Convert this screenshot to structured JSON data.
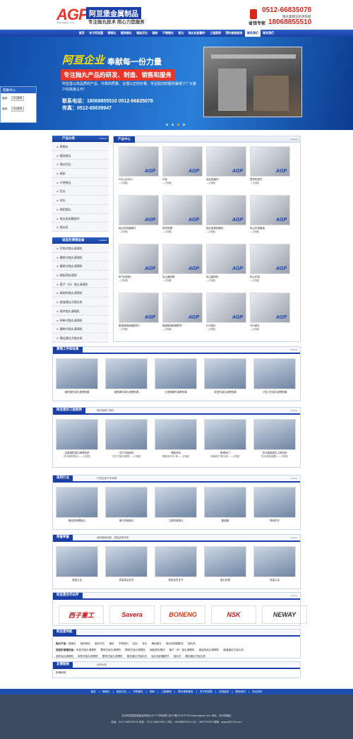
{
  "header": {
    "logo": "AGP",
    "logo_sub": "www.agpzp.com",
    "company": "阿亘堡金属制品",
    "slogan": "专注抛丸技术 用心力您服务",
    "phone1": "0512-66835078",
    "phone_tag": "钢丸集销读砂项购者",
    "phone2_label": "省钱专家",
    "phone2": "18068855510"
  },
  "nav": [
    "首页",
    "关于阿亘堡",
    "铸钢丸",
    "镀锌钢丸",
    "钢丝切丸",
    "钢砂",
    "不锈钢丸",
    "铝丸",
    "抛丸机耐磨件",
    "工程案例",
    "预约维修服务",
    "联系我们",
    "联系我们"
  ],
  "banner": {
    "title": "阿亘企业",
    "tagline": "奉献每一份力量",
    "bar": "专注抛丸产品的研发、制造、销售和服务",
    "text": "阿亘堡以高品质的产品、可靠的质量、合理公正的价格、专业贴切的服务赢得了广大客户的高度认可!",
    "tel_line": "联系电话：18068855510 0512-66835078",
    "fax_line": "传真：0512-68639947"
  },
  "kefu": {
    "title": "客服中心",
    "rows": [
      {
        "label": "客服：",
        "btn": "QQ咨询"
      },
      {
        "label": "客服：",
        "btn": "QQ咨询"
      }
    ]
  },
  "sidebar1": {
    "title": "产品分类",
    "more": "+more",
    "items": [
      "铸钢丸",
      "镀锌钢丸",
      "钢丝切丸",
      "钢砂",
      "不锈钢丸",
      "铝丸",
      "锌丸",
      "铸铝钢丸",
      "抛丸机耐磨配件",
      "抛丸机"
    ]
  },
  "sidebar2": {
    "title": "适宜的清理设备",
    "more": "+more",
    "items": [
      "吊钩式抛丸清理机",
      "履带式抛丸清理机",
      "履带式抛丸清理机",
      "钢板预处理线",
      "管子（外）抛丸清理机",
      "钢结构抛丸清理机",
      "辊道通过式抛丸机",
      "钢件抛丸清理机",
      "网带式抛丸清理机",
      "履带式抛丸清理机",
      "悬挂通过式抛丸机"
    ]
  },
  "products": {
    "title": "产品中心",
    "more": "+more",
    "items": [
      {
        "name": "叶片(全为叶)",
        "more": "—[详细]"
      },
      {
        "name": "叶轮",
        "more": "—[详细]"
      },
      {
        "name": "抛丸耐磨件",
        "more": "—[详细]"
      },
      {
        "name": "里弄机配件",
        "more": "—[详细]"
      },
      {
        "name": "抛丸机耐磨套件",
        "more": "—[详细]"
      },
      {
        "name": "滚环配置",
        "more": "—[详细]"
      },
      {
        "name": "抛丸铸造耐磨件",
        "more": "—[详细]"
      },
      {
        "name": "除尘布袋套装",
        "more": "—[详细]"
      },
      {
        "name": "电气控制柜",
        "more": "—[详细]"
      },
      {
        "name": "除尘器滤筒",
        "more": "—[详细]"
      },
      {
        "name": "除尘器风机",
        "more": "—[详细]"
      },
      {
        "name": "除尘布袋",
        "more": "—[详细]"
      },
      {
        "name": "管道铸造耐磨配件2",
        "more": "—[详细]"
      },
      {
        "name": "管道铸造耐磨配件",
        "more": "—[详细]"
      },
      {
        "name": "834抛丸",
        "more": "—[详细]"
      },
      {
        "name": "360抛丸",
        "more": "—[详细]"
      }
    ]
  },
  "effect": {
    "title": "清理工件和效果",
    "more": "+more",
    "items": [
      "钢铁铸件抛丸清理效果",
      "钢铁铸件抛丸清理效果",
      "大型铸钢件清理效果",
      "异型件抛丸清理效果",
      "小型工件抛丸清理效果"
    ]
  },
  "cases": {
    "title": "阿亘堡的工程案例",
    "subtitle": "他们选择了我们",
    "more": "+more",
    "items": [
      {
        "name": "冶重钢机抛丸清理系统",
        "sub": "苏州钢材抛丸——[详细]"
      },
      {
        "name": "中亿丰钢结构",
        "sub": "中亿丰抛丸清理——[详细]"
      },
      {
        "name": "博能传动",
        "sub": "博能传动丰 清——[详细]"
      },
      {
        "name": "新威阀门",
        "sub": "新威阀门抛丸清——[详细]"
      },
      {
        "name": "苏州重装抛丸工程系统",
        "sub": "苏州重装装置——[详细]"
      }
    ]
  },
  "industry": {
    "title": "适用行业",
    "subtitle": "产品应用于多领域",
    "more": "+more",
    "items": [
      "钢结构清理抛丸",
      "港口机械抛丸",
      "工程机械抛丸",
      "集装箱",
      "铁轨机车"
    ]
  },
  "honor": {
    "title": "荣誉荣誉",
    "subtitle": "诚信铸就品质，质量赢得未来",
    "more": "+more",
    "items": [
      "质量认证",
      "质量保证证书",
      "诚信会员证书",
      "营业执照",
      "质量认证"
    ]
  },
  "partners": {
    "title": "阿亘堡合作伙伴",
    "more": "+more",
    "items": [
      {
        "name": "西子重工",
        "color": "#c4171a"
      },
      {
        "name": "Savera",
        "color": "#c4171a"
      },
      {
        "name": "BONENG",
        "color": "#d43a1a"
      },
      {
        "name": "NSK",
        "color": "#c4171a"
      },
      {
        "name": "NEWAY",
        "color": "#333333"
      }
    ]
  },
  "links": {
    "title": "阿亘堡导航",
    "rows": [
      {
        "label": "抛丸产品：",
        "items": [
          "铸钢丸",
          "镀锌钢丸",
          "钢丝切丸",
          "钢砂",
          "不锈钢丸",
          "铝丸",
          "锌丸",
          "铸铝钢丸",
          "抛丸机耐磨配件",
          "抛丸机"
        ]
      },
      {
        "label": "适宜的清理设备：",
        "items": [
          "吊钩式抛丸清理机",
          "履带式抛丸清理机",
          "履带式抛丸清理机",
          "钢板预处理线",
          "管子（外）抛丸清理机",
          "钢结构抛丸清理机",
          "辊道通过式抛丸机"
        ]
      },
      {
        "label": "",
        "items": [
          "钢件抛丸清理机",
          "网带式抛丸清理机",
          "履带式抛丸清理机",
          "悬挂通过式抛丸机",
          "抛丸机耐磨配件",
          "抛丸机",
          "悬挂通过式抛丸机"
        ]
      }
    ]
  },
  "friends": {
    "title": "友情链接",
    "note": "合作伙伴",
    "first": "镇海网络"
  },
  "footer": {
    "nav": [
      "首页",
      "铸钢丸",
      "钢丝切丸",
      "不锈钢丸",
      "钢砂",
      "工程案例",
      "预约维修服务",
      "关于阿亘堡",
      "在线留言",
      "联系我们",
      "热点资讯"
    ],
    "line1": "苏州阿亘堡金属制品有限公司 © 所有版权  苏ICP备12015708  www.agpzp.com   地址：苏州相城区",
    "line2": "电话：0512-66835078  传真：0512-68639947  手机：18068855510  QQ：260795050  邮箱：agpzp@126.com"
  }
}
